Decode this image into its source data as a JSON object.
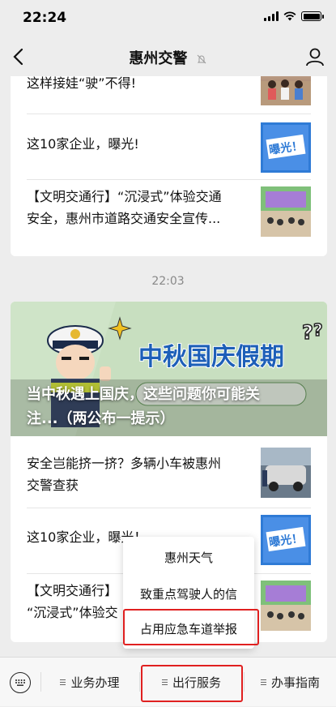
{
  "status_bar": {
    "time": "22:24"
  },
  "nav": {
    "title": "惠州交警"
  },
  "top_card": {
    "items": [
      {
        "title": "这样接娃“驶”不得!"
      },
      {
        "title": "这10家企业，曝光!"
      },
      {
        "title_line1": "【文明交通行】“沉浸式”体验交通",
        "title_line2": "安全，惠州市道路交通安全宣传..."
      }
    ]
  },
  "timestamp": "22:03",
  "main_card": {
    "banner": {
      "image_text": "中秋国庆假期",
      "title_line1": "当中秋遇上国庆，这些问题你可能关",
      "title_line2": "注...（两公布一提示）"
    },
    "items": [
      {
        "title_line1": "安全岂能挤一挤？多辆小车被惠州",
        "title_line2": "交警查获"
      },
      {
        "title": "这10家企业，曝光！"
      },
      {
        "title_line1": "【文明交通行】",
        "title_line2": "“沉浸式”体验交"
      }
    ],
    "thumb_text": "曝光！"
  },
  "popup_menu": {
    "items": [
      {
        "label": "惠州天气"
      },
      {
        "label": "致重点驾驶人的信"
      },
      {
        "label": "占用应急车道举报"
      }
    ]
  },
  "bottom_menu": {
    "tabs": [
      {
        "label": "业务办理"
      },
      {
        "label": "出行服务"
      },
      {
        "label": "办事指南"
      }
    ]
  },
  "colors": {
    "highlight": "#e02020",
    "accent_blue": "#2f7bd6"
  }
}
